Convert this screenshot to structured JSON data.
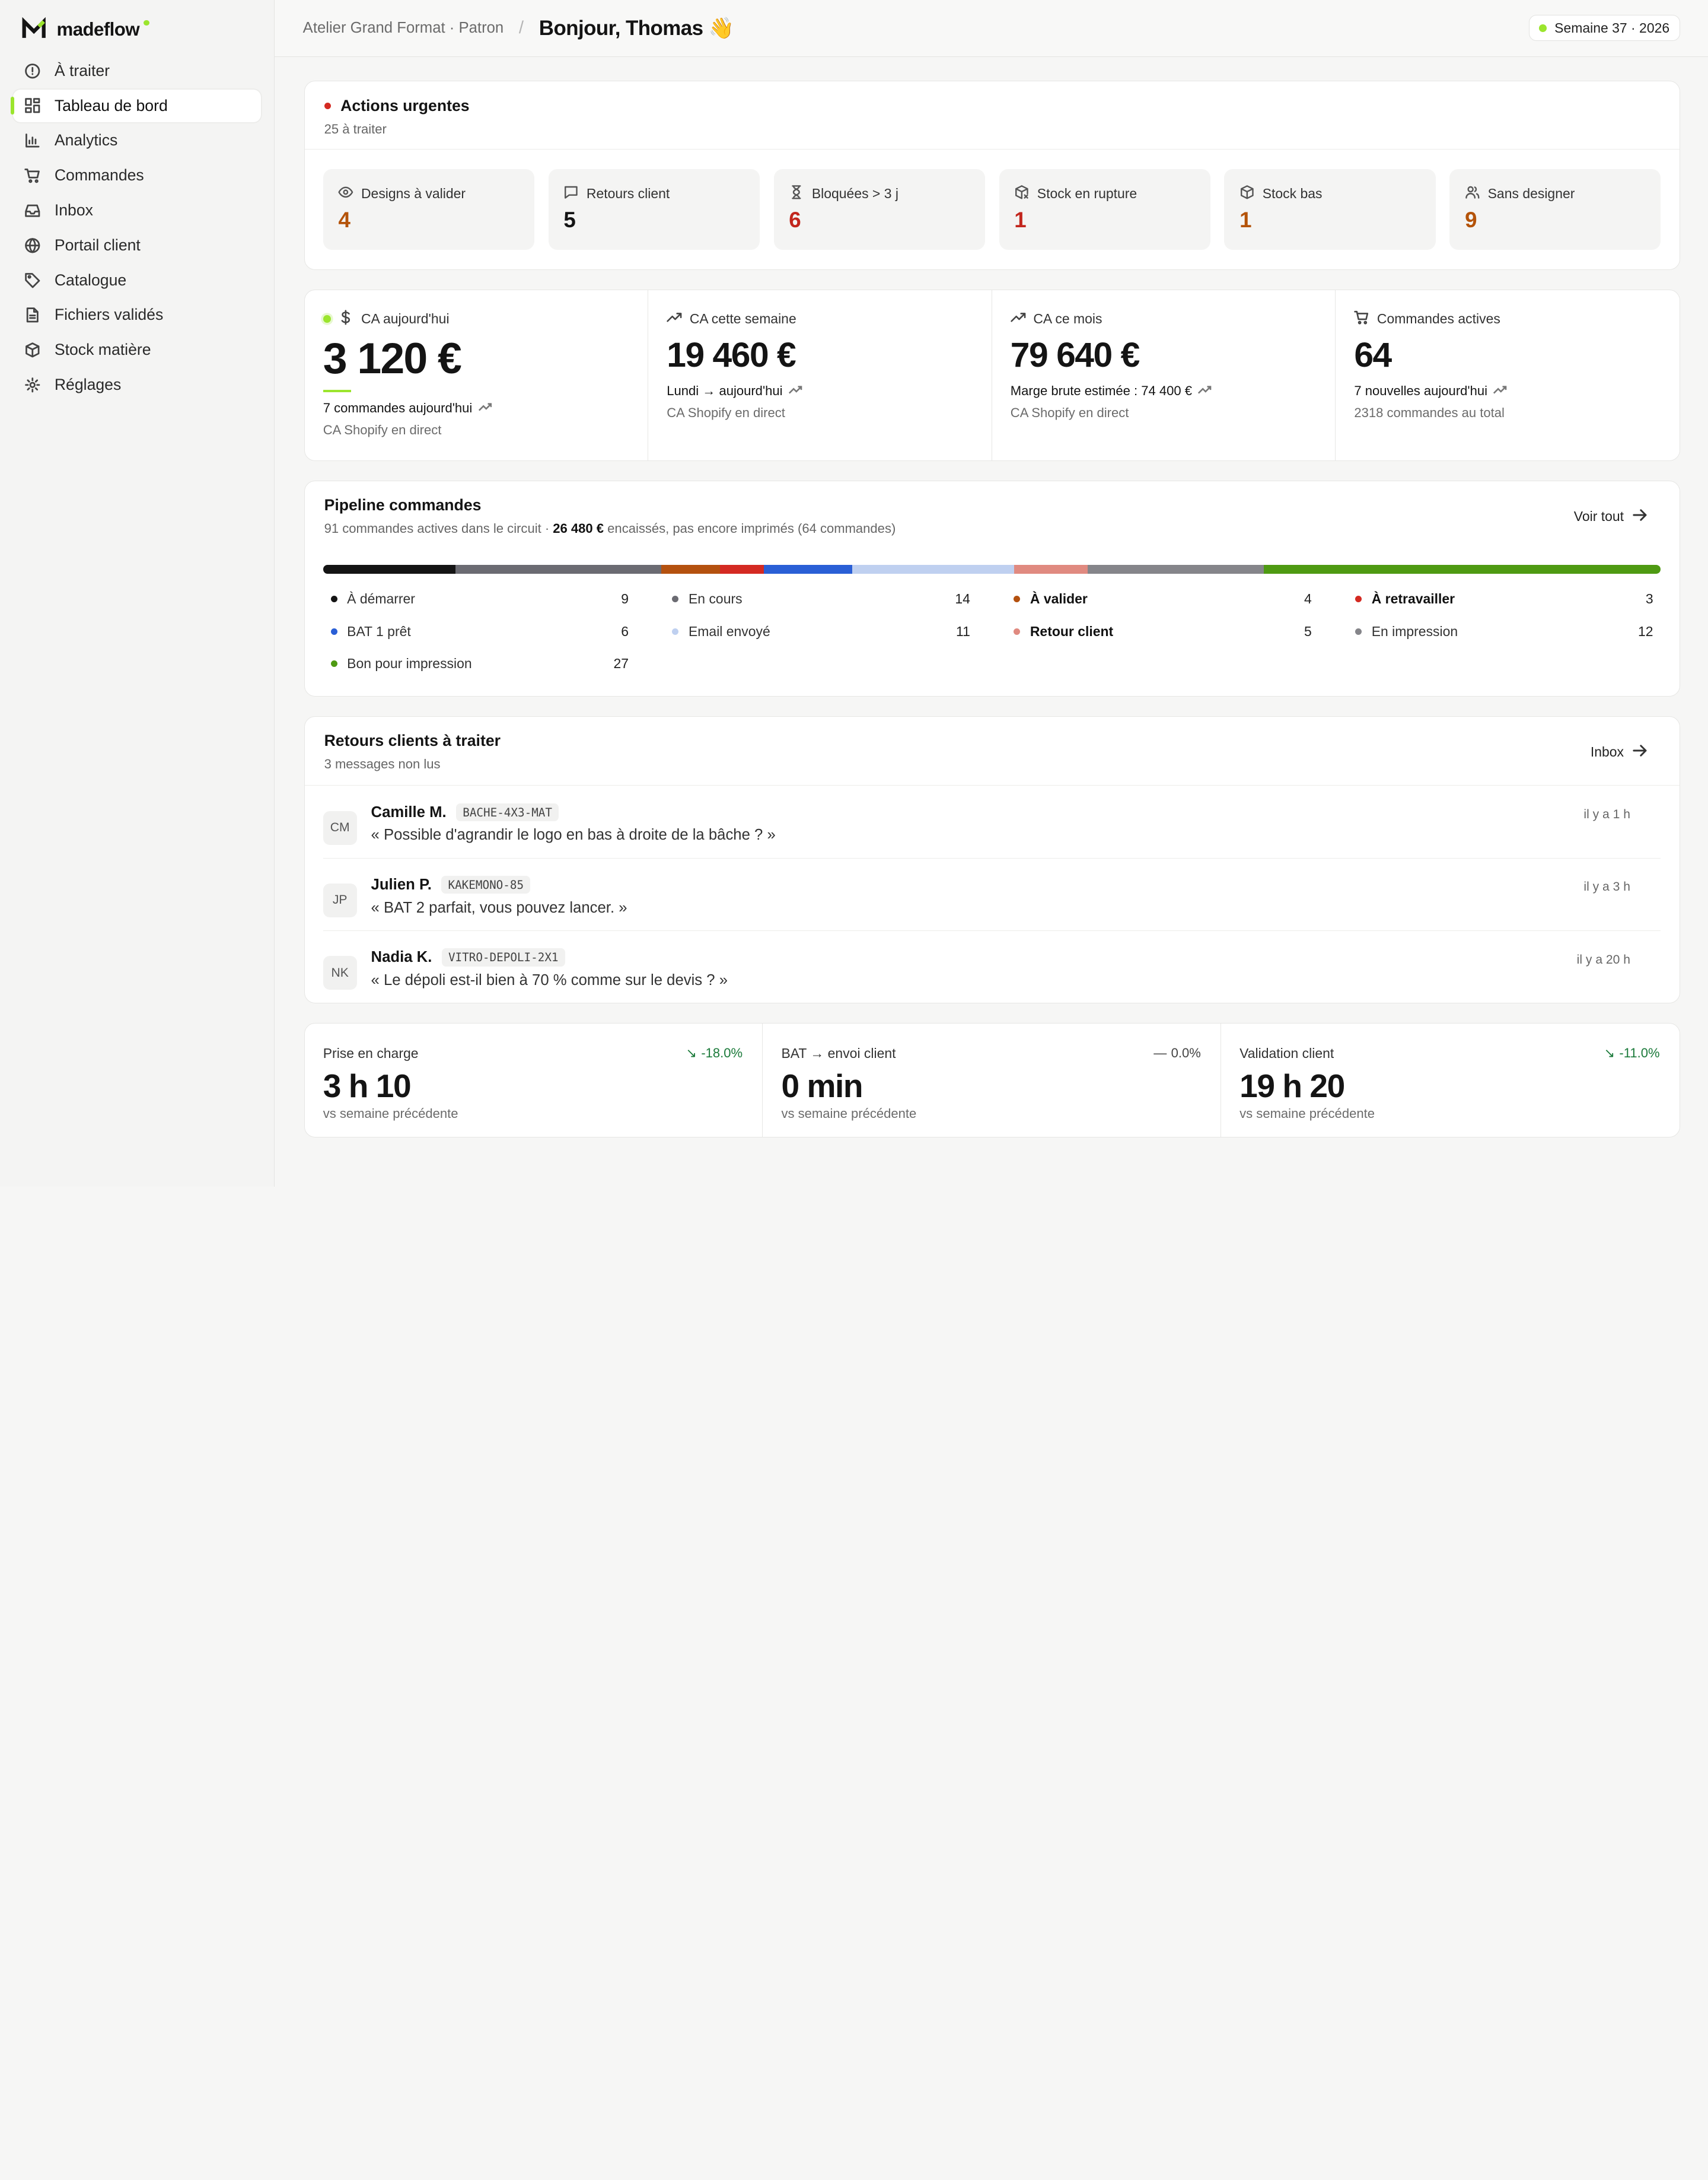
{
  "brand": {
    "name": "madeflow",
    "accent": "#9be52d"
  },
  "sidebar": {
    "items": [
      {
        "label": "À traiter",
        "icon": "alert-circle-icon",
        "active": false
      },
      {
        "label": "Tableau de bord",
        "icon": "dashboard-icon",
        "active": true
      },
      {
        "label": "Analytics",
        "icon": "bar-chart-icon",
        "active": false
      },
      {
        "label": "Commandes",
        "icon": "cart-icon",
        "active": false
      },
      {
        "label": "Inbox",
        "icon": "inbox-icon",
        "active": false
      },
      {
        "label": "Portail client",
        "icon": "globe-icon",
        "active": false
      },
      {
        "label": "Catalogue",
        "icon": "tag-icon",
        "active": false
      },
      {
        "label": "Fichiers validés",
        "icon": "file-icon",
        "active": false
      },
      {
        "label": "Stock matière",
        "icon": "package-icon",
        "active": false
      },
      {
        "label": "Réglages",
        "icon": "gear-icon",
        "active": false
      }
    ]
  },
  "header": {
    "breadcrumb": "Atelier Grand Format · Patron",
    "greeting": "Bonjour, Thomas 👋",
    "week": "Semaine 37 · 2026"
  },
  "urgent": {
    "title": "Actions urgentes",
    "subtitle": "25 à traiter",
    "tiles": [
      {
        "label": "Designs à valider",
        "value": "4",
        "icon": "eye-icon",
        "color": "#b45309"
      },
      {
        "label": "Retours client",
        "value": "5",
        "icon": "message-icon",
        "color": "#141414"
      },
      {
        "label": "Bloquées > 3 j",
        "value": "6",
        "icon": "hourglass-icon",
        "color": "#c2261d"
      },
      {
        "label": "Stock en rupture",
        "value": "1",
        "icon": "package-x-icon",
        "color": "#c2261d"
      },
      {
        "label": "Stock bas",
        "value": "1",
        "icon": "package-icon",
        "color": "#b45309"
      },
      {
        "label": "Sans designer",
        "value": "9",
        "icon": "users-icon",
        "color": "#b45309"
      }
    ]
  },
  "kpis": [
    {
      "label": "CA aujourd'hui",
      "value": "3 120 €",
      "line1": "7 commandes aujourd'hui",
      "line2": "CA Shopify en direct",
      "icon": "dollar-icon"
    },
    {
      "label": "CA cette semaine",
      "value": "19 460 €",
      "line1": "Lundi → aujourd'hui",
      "line2": "CA Shopify en direct",
      "icon": "trending-up-icon"
    },
    {
      "label": "CA ce mois",
      "value": "79 640 €",
      "line1": "Marge brute estimée : 74 400 €",
      "line2": "CA Shopify en direct",
      "icon": "trending-up-icon"
    },
    {
      "label": "Commandes actives",
      "value": "64",
      "line1": "7 nouvelles aujourd'hui",
      "line2": "2318 commandes au total",
      "icon": "cart-icon"
    }
  ],
  "pipeline": {
    "title": "Pipeline commandes",
    "subtitle_prefix": "91 commandes actives dans le circuit · ",
    "subtitle_amount": "26 480 €",
    "subtitle_suffix": " encaissés, pas encore imprimés (64 commandes)",
    "link": "Voir tout",
    "stages": [
      {
        "name": "À démarrer",
        "count": 9,
        "color": "#141414",
        "emphasis": false
      },
      {
        "name": "En cours",
        "count": 14,
        "color": "#6b6b72",
        "emphasis": false
      },
      {
        "name": "À valider",
        "count": 4,
        "color": "#b4510f",
        "emphasis": true
      },
      {
        "name": "À retravailler",
        "count": 3,
        "color": "#d42a22",
        "emphasis": true
      },
      {
        "name": "BAT 1 prêt",
        "count": 6,
        "color": "#2a5fd6",
        "emphasis": false
      },
      {
        "name": "Email envoyé",
        "count": 11,
        "color": "#bfd0f0",
        "emphasis": false
      },
      {
        "name": "Retour client",
        "count": 5,
        "color": "#e08a80",
        "emphasis": true
      },
      {
        "name": "En impression",
        "count": 12,
        "color": "#85858a",
        "emphasis": false
      },
      {
        "name": "Bon pour impression",
        "count": 27,
        "color": "#4e9a12",
        "emphasis": false
      }
    ]
  },
  "returns": {
    "title": "Retours clients à traiter",
    "subtitle": "3 messages non lus",
    "link": "Inbox",
    "messages": [
      {
        "initials": "CM",
        "name": "Camille M.",
        "ref": "BACHE-4X3-MAT",
        "text": "« Possible d'agrandir le logo en bas à droite de la bâche ? »",
        "time": "il y a 1 h"
      },
      {
        "initials": "JP",
        "name": "Julien P.",
        "ref": "KAKEMONO-85",
        "text": "« BAT 2 parfait, vous pouvez lancer. »",
        "time": "il y a 3 h"
      },
      {
        "initials": "NK",
        "name": "Nadia K.",
        "ref": "VITRO-DEPOLI-2X1",
        "text": "« Le dépoli est-il bien à 70 % comme sur le devis ? »",
        "time": "il y a 20 h"
      }
    ]
  },
  "metrics": [
    {
      "label": "Prise en charge",
      "delta": "-18.0%",
      "trend": "down",
      "value": "3 h 10",
      "sub": "vs semaine précédente"
    },
    {
      "label": "BAT → envoi client",
      "delta": "0.0%",
      "trend": "flat",
      "value": "0 min",
      "sub": "vs semaine précédente"
    },
    {
      "label": "Validation client",
      "delta": "-11.0%",
      "trend": "down",
      "value": "19 h 20",
      "sub": "vs semaine précédente"
    }
  ]
}
